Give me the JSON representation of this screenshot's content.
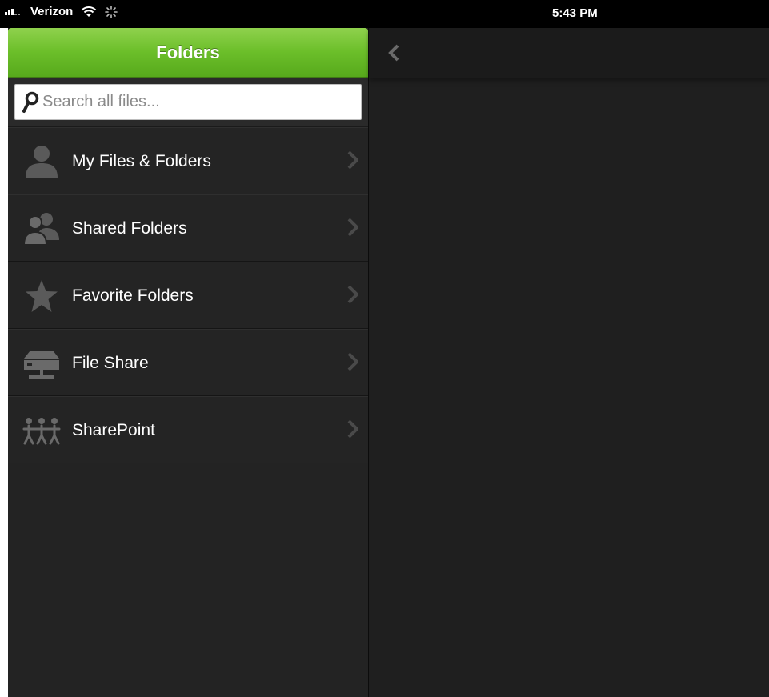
{
  "status_bar": {
    "carrier": "Verizon",
    "time": "5:43 PM"
  },
  "sidebar": {
    "title": "Folders",
    "search": {
      "placeholder": "Search all files...",
      "value": ""
    },
    "items": [
      {
        "label": "My Files & Folders",
        "icon": "person-icon"
      },
      {
        "label": "Shared Folders",
        "icon": "group-icon"
      },
      {
        "label": "Favorite Folders",
        "icon": "star-icon"
      },
      {
        "label": "File Share",
        "icon": "server-icon"
      },
      {
        "label": "SharePoint",
        "icon": "sharepoint-people-icon"
      }
    ]
  },
  "detail": {
    "back_icon": "chevron-left-icon"
  },
  "colors": {
    "header_green": "#6cbf2a",
    "panel_bg": "#242424",
    "detail_bg": "#1f1f1f"
  }
}
